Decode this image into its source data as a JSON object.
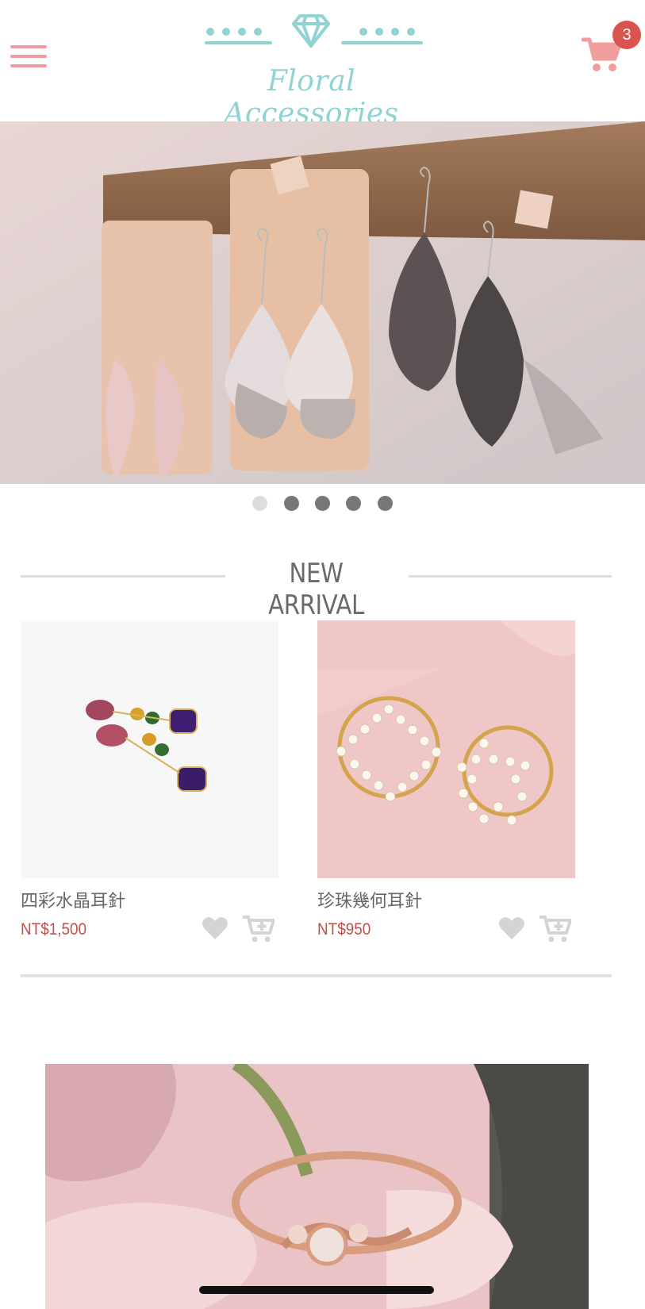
{
  "brand": {
    "name": "Floral Accessories",
    "primary_color": "#8fd3d3",
    "accent_color": "#ef9d9d",
    "price_color": "#c0504d"
  },
  "header": {
    "menu_icon": "hamburger-icon",
    "logo_icon": "diamond-icon",
    "cart_icon": "cart-icon",
    "cart_count": "3"
  },
  "hero": {
    "image_subject": "leather earrings hanging on cork board",
    "slides": 5,
    "active_slide": 1
  },
  "new_arrival": {
    "title": "NEW ARRIVAL",
    "products": [
      {
        "name": "四彩水晶耳針",
        "price": "NT$1,500",
        "image_subject": "multi-color crystal drop earrings",
        "favorite_icon": "heart-icon",
        "cart_icon": "add-to-cart-icon"
      },
      {
        "name": "珍珠幾何耳針",
        "price": "NT$950",
        "image_subject": "pearl geometric hoop earrings",
        "favorite_icon": "heart-icon",
        "cart_icon": "add-to-cart-icon"
      }
    ]
  },
  "banner": {
    "image_subject": "rose gold ring on pink flower"
  }
}
